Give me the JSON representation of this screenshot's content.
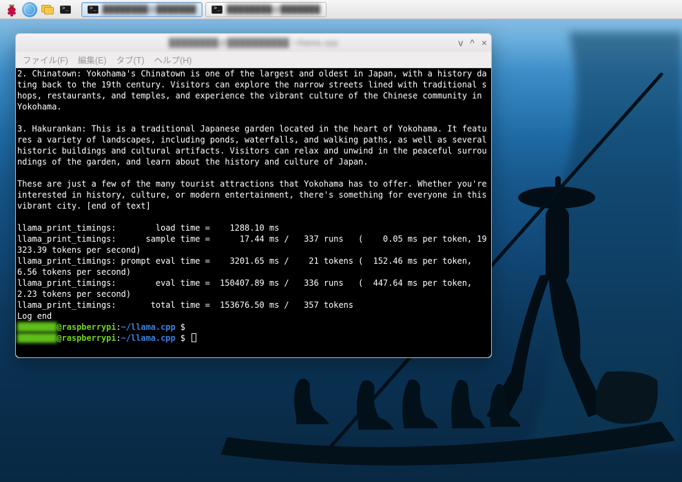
{
  "taskbar": {
    "items": [
      {
        "label_masked": "████████@███████"
      },
      {
        "label_masked": "████████@███████"
      }
    ]
  },
  "window": {
    "title_masked": "████████@██████████ ~/llama.cpp",
    "menu": {
      "file": "ファイル(F)",
      "edit": "編集(E)",
      "tab": "タブ(T)",
      "help": "ヘルプ(H)"
    },
    "controls": {
      "min": "v",
      "max": "^",
      "close": "×"
    }
  },
  "terminal": {
    "body_lines": [
      "2. Chinatown: Yokohama's Chinatown is one of the largest and oldest in Japan, with a history dating back to the 19th century. Visitors can explore the narrow streets lined with traditional shops, restaurants, and temples, and experience the vibrant culture of the Chinese community in Yokohama.",
      "",
      "3. Hakurankan: This is a traditional Japanese garden located in the heart of Yokohama. It features a variety of landscapes, including ponds, waterfalls, and walking paths, as well as several historic buildings and cultural artifacts. Visitors can relax and unwind in the peaceful surroundings of the garden, and learn about the history and culture of Japan.",
      "",
      "These are just a few of the many tourist attractions that Yokohama has to offer. Whether you're interested in history, culture, or modern entertainment, there's something for everyone in this vibrant city. [end of text]",
      "",
      "llama_print_timings:        load time =    1288.10 ms",
      "llama_print_timings:      sample time =      17.44 ms /   337 runs   (    0.05 ms per token, 19323.39 tokens per second)",
      "llama_print_timings: prompt eval time =    3201.65 ms /    21 tokens (  152.46 ms per token,     6.56 tokens per second)",
      "llama_print_timings:        eval time =  150407.89 ms /   336 runs   (  447.64 ms per token,     2.23 tokens per second)",
      "llama_print_timings:       total time =  153676.50 ms /   357 tokens",
      "Log end"
    ],
    "prompt": {
      "user_masked": "████████",
      "at": "@raspberrypi",
      "colon": ":",
      "path": "~/llama.cpp",
      "dollar": " $ "
    }
  }
}
